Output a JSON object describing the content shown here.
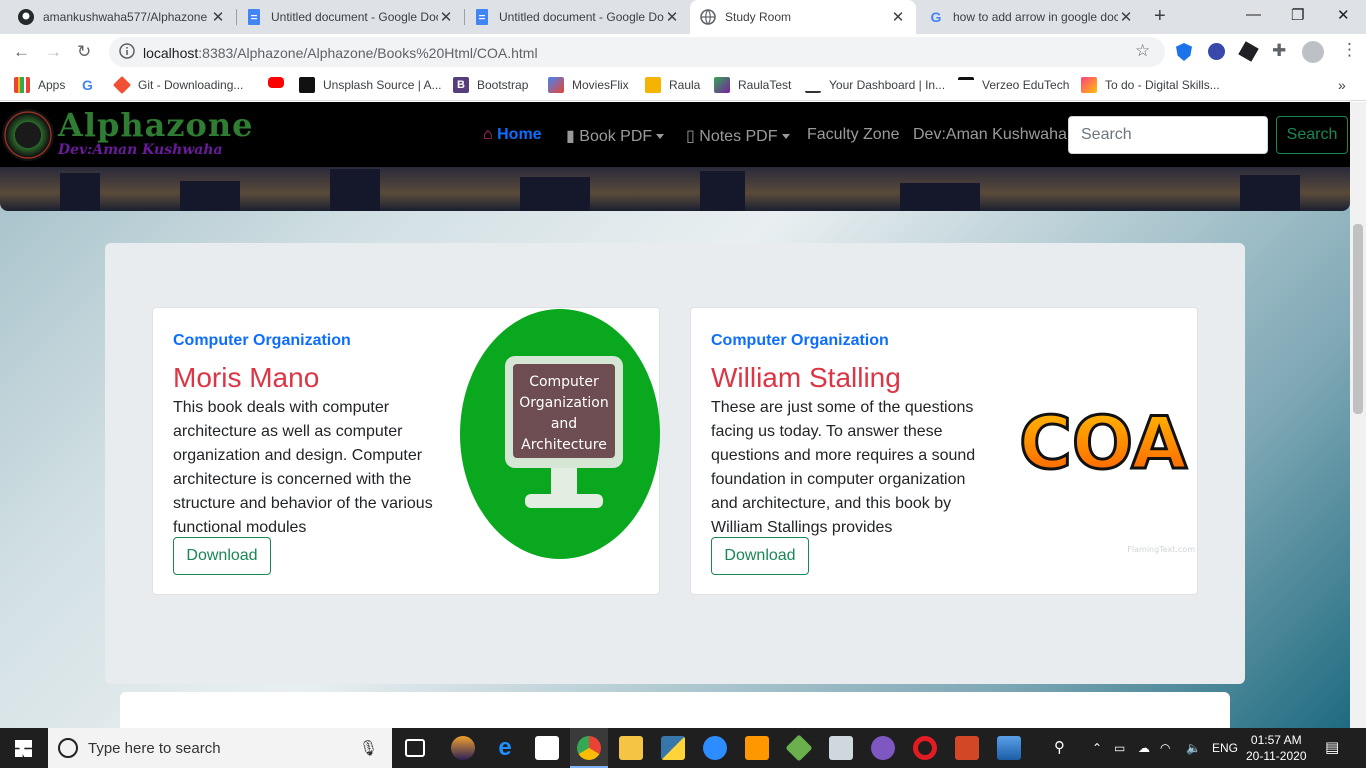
{
  "tabs": [
    {
      "title": "amankushwaha577/Alphazone"
    },
    {
      "title": "Untitled document - Google Docs"
    },
    {
      "title": "Untitled document - Google Docs"
    },
    {
      "title": "Study Room"
    },
    {
      "title": "how to add arrow in google docs"
    }
  ],
  "address": {
    "host": "localhost",
    "rest": ":8383/Alphazone/Alphazone/Books%20Html/COA.html"
  },
  "bookmarks": [
    "Apps",
    "Git - Downloading...",
    "Unsplash Source | A...",
    "Bootstrap",
    "MoviesFlix",
    "Raula",
    "RaulaTest",
    "Your Dashboard | In...",
    "Verzeo EduTech",
    "To do - Digital Skills..."
  ],
  "site": {
    "brand": "Alphazone",
    "brand_sub": "Dev:Aman Kushwaha",
    "nav": {
      "home": "Home",
      "book_pdf": "Book PDF",
      "notes_pdf": "Notes PDF",
      "faculty": "Faculty Zone",
      "dev": "Dev:Aman Kushwaha"
    },
    "search_placeholder": "Search",
    "search_button": "Search"
  },
  "cards": [
    {
      "category": "Computer Organization",
      "author": "Moris Mano",
      "description": "This book deals with computer architecture as well as computer organization and design. Computer architecture is concerned with the structure and behavior of the various functional modules",
      "button": "Download",
      "image_text": [
        "Computer",
        "Organization",
        "and",
        "Architecture"
      ]
    },
    {
      "category": "Computer Organization",
      "author": "William Stalling",
      "description": "These are just some of the questions facing us today. To answer these questions and more requires a sound foundation in computer organization and architecture, and this book by William Stallings provides",
      "button": "Download",
      "image_text": [
        "COA"
      ],
      "watermark": "FlamingText.com"
    }
  ],
  "taskbar": {
    "search_placeholder": "Type here to search",
    "time": "01:57 AM",
    "date": "20-11-2020",
    "lang": "ENG"
  },
  "colors": {
    "primary": "#0d6efd",
    "success": "#198754",
    "danger": "#dc3545",
    "navbar": "#000000"
  }
}
